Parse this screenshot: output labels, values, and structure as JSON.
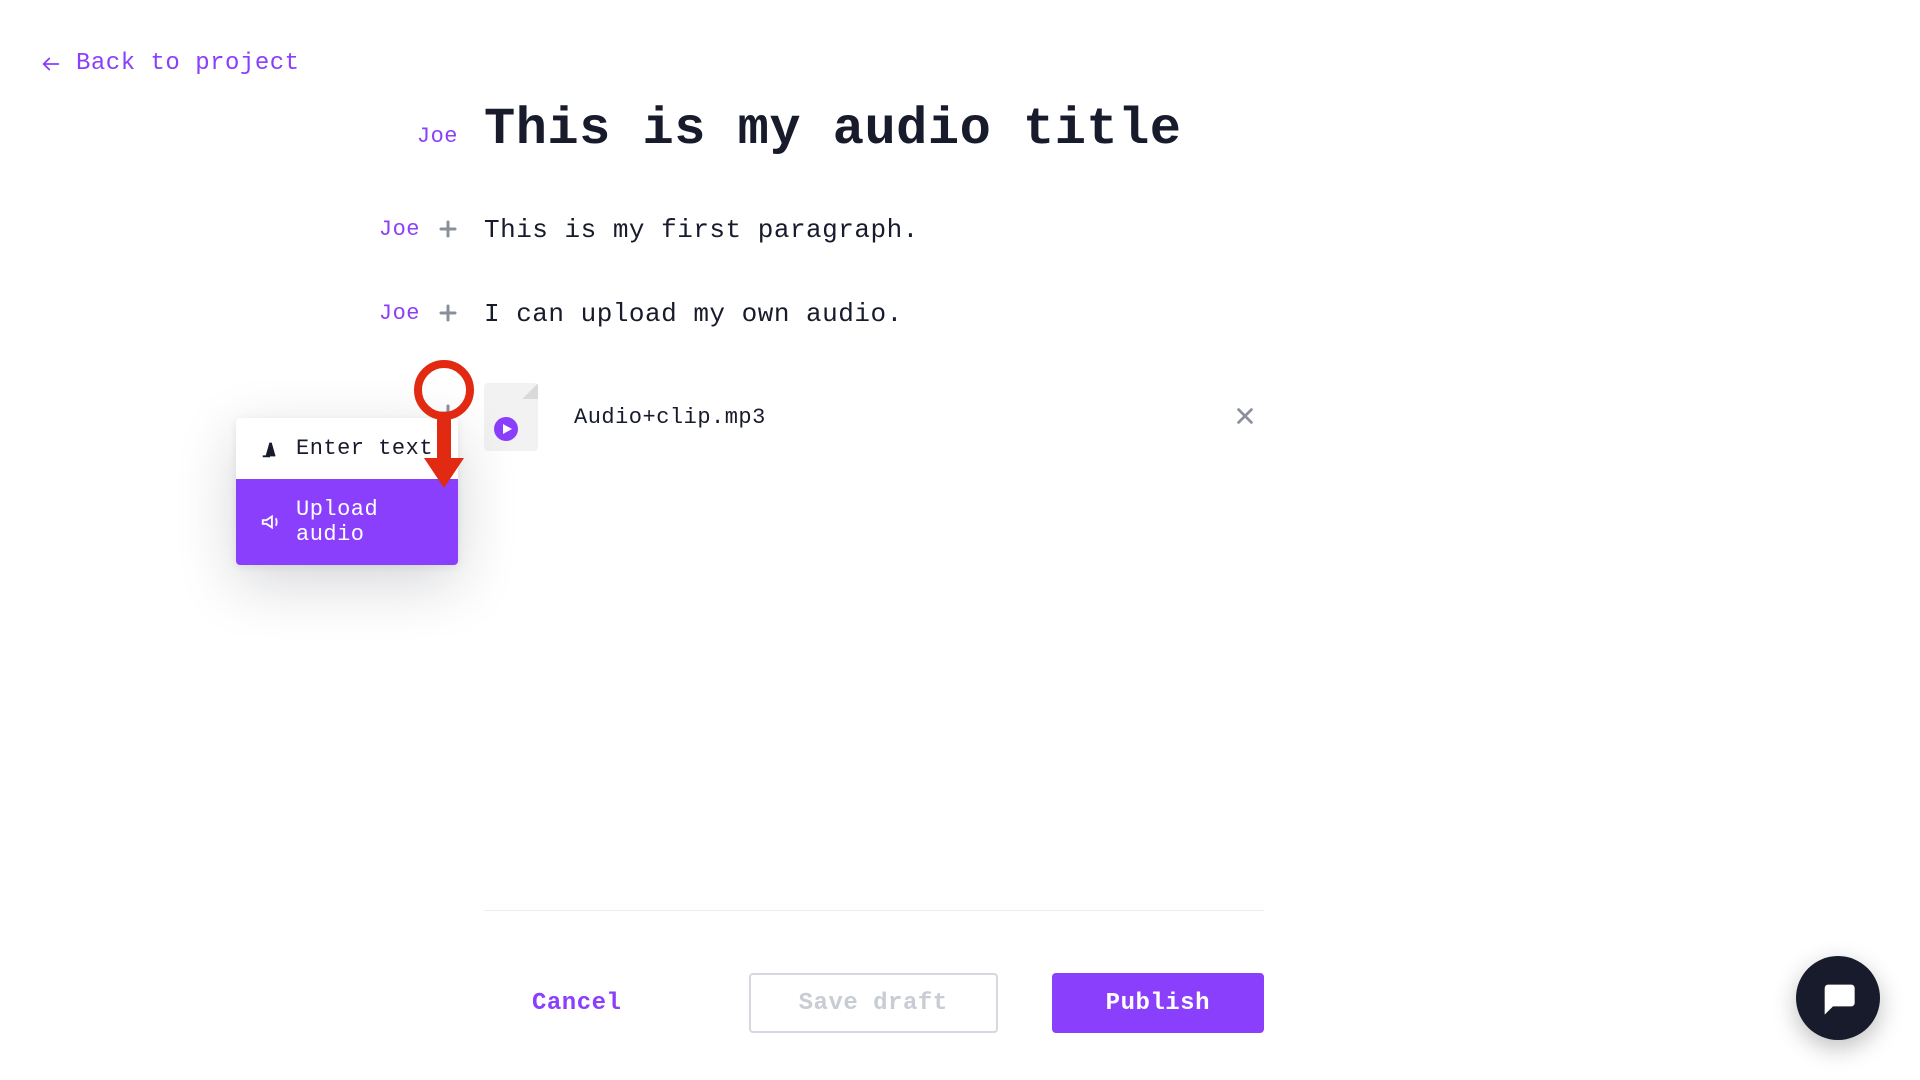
{
  "nav": {
    "back_label": "Back to project"
  },
  "author": "Joe",
  "title": "This is my audio title",
  "paragraphs": [
    "This is my first paragraph.",
    "I can upload my own audio."
  ],
  "audio_block": {
    "file_name": "Audio+clip.mp3"
  },
  "add_menu": {
    "text_option": "Enter text",
    "audio_option": "Upload audio"
  },
  "footer": {
    "cancel": "Cancel",
    "save_draft": "Save draft",
    "publish": "Publish"
  },
  "colors": {
    "accent": "#8a3ffc",
    "annotation": "#e22a12",
    "fab_bg": "#171b2b"
  }
}
